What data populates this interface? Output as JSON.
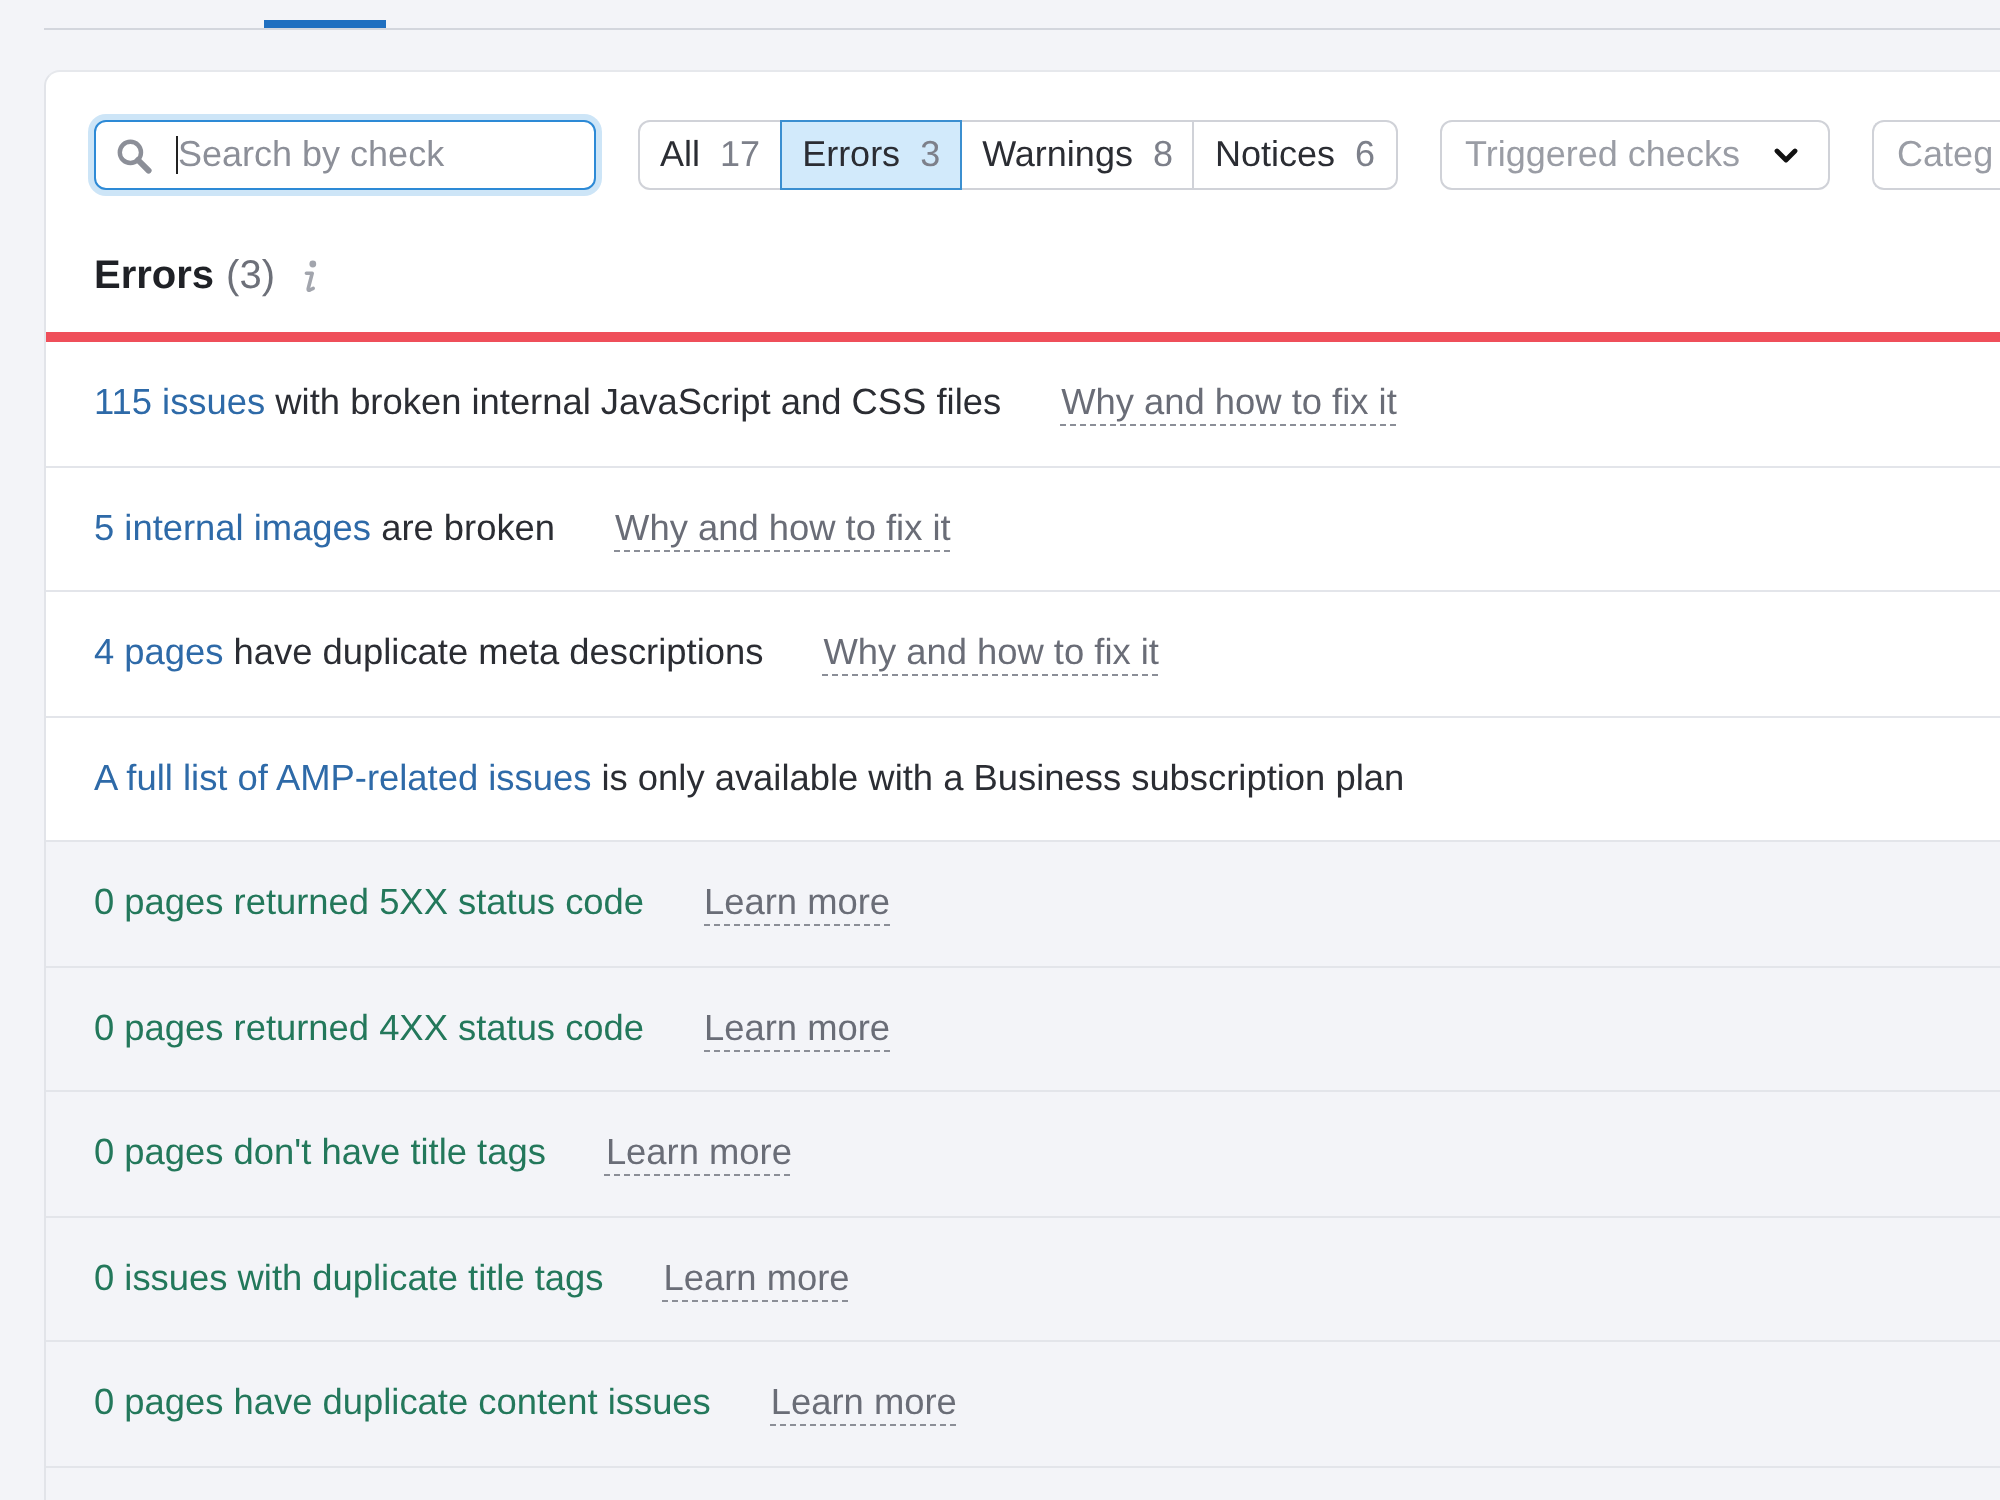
{
  "search": {
    "placeholder": "Search by check",
    "focused": true
  },
  "filters": [
    {
      "label": "All",
      "count": "17",
      "selected": false
    },
    {
      "label": "Errors",
      "count": "3",
      "selected": true
    },
    {
      "label": "Warnings",
      "count": "8",
      "selected": false
    },
    {
      "label": "Notices",
      "count": "6",
      "selected": false
    }
  ],
  "triggered_checks": {
    "label": "Triggered checks"
  },
  "category_filter": {
    "label": "Categ"
  },
  "section": {
    "title": "Errors",
    "count": "(3)"
  },
  "checks": [
    {
      "kind": "error",
      "link": "115 issues",
      "text": "with broken internal JavaScript and CSS files",
      "help": "Why and how to fix it"
    },
    {
      "kind": "error",
      "link": "5 internal images",
      "text": "are broken",
      "help": "Why and how to fix it"
    },
    {
      "kind": "error",
      "link": "4 pages",
      "text": "have duplicate meta descriptions",
      "help": "Why and how to fix it"
    },
    {
      "kind": "error",
      "link": "A full list of AMP-related issues",
      "text": "is only available with a Business subscription plan"
    },
    {
      "kind": "passed",
      "text": "0 pages returned 5XX status code",
      "help": "Learn more"
    },
    {
      "kind": "passed",
      "text": "0 pages returned 4XX status code",
      "help": "Learn more"
    },
    {
      "kind": "passed",
      "text": "0 pages don't have title tags",
      "help": "Learn more"
    },
    {
      "kind": "passed",
      "text": "0 issues with duplicate title tags",
      "help": "Learn more"
    },
    {
      "kind": "passed",
      "text": "0 pages have duplicate content issues",
      "help": "Learn more"
    }
  ]
}
